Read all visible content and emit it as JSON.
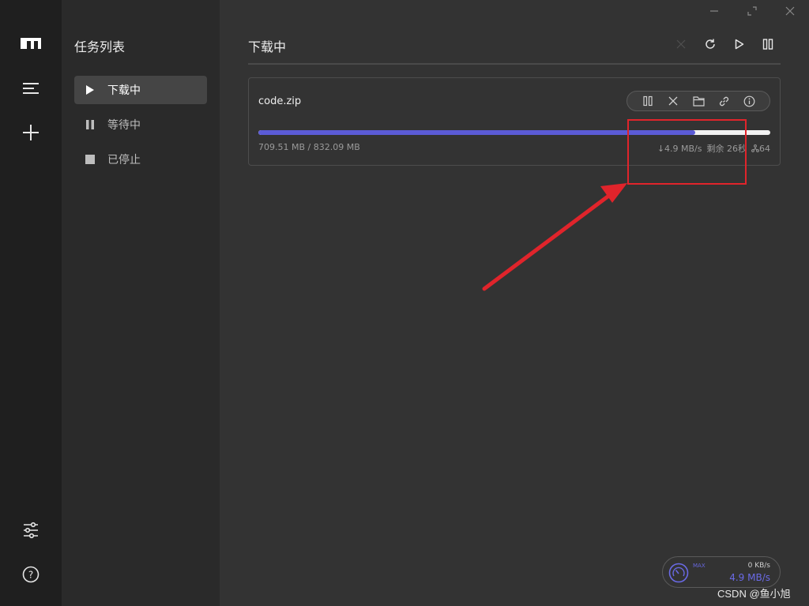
{
  "sidebar": {
    "title": "任务列表",
    "items": [
      {
        "label": "下载中",
        "icon": "play-icon",
        "active": true
      },
      {
        "label": "等待中",
        "icon": "pause-icon",
        "active": false
      },
      {
        "label": "已停止",
        "icon": "stop-icon",
        "active": false
      }
    ]
  },
  "rail": {
    "icons": [
      "logo-icon",
      "menu-icon",
      "add-icon",
      "settings-icon",
      "help-icon"
    ]
  },
  "window_controls": [
    "minimize-icon",
    "maximize-icon",
    "close-icon"
  ],
  "main": {
    "title": "下载中",
    "toolbar": [
      "clear-icon",
      "refresh-icon",
      "resume-all-icon",
      "pause-all-icon"
    ]
  },
  "task": {
    "filename": "code.zip",
    "actions": [
      "pause-icon",
      "delete-icon",
      "folder-icon",
      "link-icon",
      "info-icon"
    ],
    "progress": 0.8527,
    "completed": "709.51 MB",
    "total": "832.09 MB",
    "sizes_text": "709.51 MB / 832.09 MB",
    "speed_text": "↓4.9 MB/s",
    "remaining_text": "剩余 26秒",
    "connections_text": "64"
  },
  "speedometer": {
    "max_label": "MAX",
    "upload": "0 KB/s",
    "download": "4.9 MB/s"
  },
  "watermark": "CSDN @鱼小旭",
  "colors": {
    "accent": "#5b5bd6",
    "annotation": "#e0242b",
    "background": "#333333",
    "rail": "#1f1f1f",
    "sidebar": "#2a2a2a"
  }
}
